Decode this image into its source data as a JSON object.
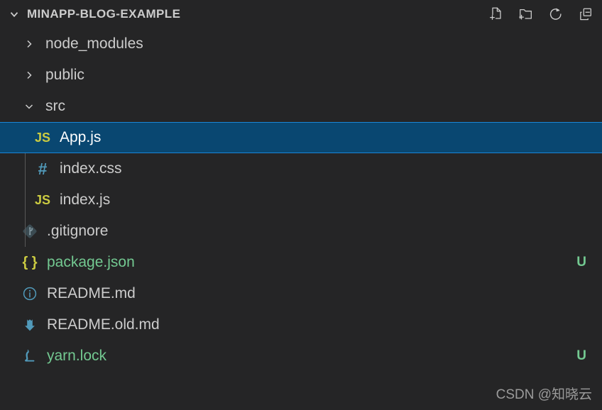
{
  "header": {
    "title": "MINAPP-BLOG-EXAMPLE",
    "expanded": true,
    "actions": [
      {
        "name": "new-file-icon",
        "tooltip": "New File"
      },
      {
        "name": "new-folder-icon",
        "tooltip": "New Folder"
      },
      {
        "name": "refresh-icon",
        "tooltip": "Refresh Explorer"
      },
      {
        "name": "collapse-all-icon",
        "tooltip": "Collapse Folders in Explorer"
      }
    ]
  },
  "tree": [
    {
      "label": "node_modules",
      "type": "folder",
      "depth": 1,
      "expanded": false,
      "icon": "chevron-right-icon",
      "badge": "",
      "selected": false
    },
    {
      "label": "public",
      "type": "folder",
      "depth": 1,
      "expanded": false,
      "icon": "chevron-right-icon",
      "badge": "",
      "selected": false
    },
    {
      "label": "src",
      "type": "folder",
      "depth": 1,
      "expanded": true,
      "icon": "chevron-down-icon",
      "badge": "",
      "selected": false
    },
    {
      "label": "App.js",
      "type": "file",
      "depth": 2,
      "icon": "js-file-icon",
      "badge": "",
      "selected": true
    },
    {
      "label": "index.css",
      "type": "file",
      "depth": 2,
      "icon": "css-file-icon",
      "badge": "",
      "selected": false
    },
    {
      "label": "index.js",
      "type": "file",
      "depth": 2,
      "icon": "js-file-icon",
      "badge": "",
      "selected": false
    },
    {
      "label": ".gitignore",
      "type": "file",
      "depth": 1,
      "icon": "git-file-icon",
      "badge": "",
      "selected": false
    },
    {
      "label": "package.json",
      "type": "file",
      "depth": 1,
      "icon": "json-file-icon",
      "badge": "U",
      "selected": false,
      "untracked": true
    },
    {
      "label": "README.md",
      "type": "file",
      "depth": 1,
      "icon": "info-file-icon",
      "badge": "",
      "selected": false
    },
    {
      "label": "README.old.md",
      "type": "file",
      "depth": 1,
      "icon": "download-arrow-icon",
      "badge": "",
      "selected": false
    },
    {
      "label": "yarn.lock",
      "type": "file",
      "depth": 1,
      "icon": "yarn-cat-icon",
      "badge": "U",
      "selected": false,
      "untracked": true
    }
  ],
  "watermark": "CSDN @知晓云",
  "colors": {
    "background": "#252526",
    "selected_row": "#094771",
    "selected_border": "#1a85d6",
    "text": "#cccccc",
    "untracked": "#73c991",
    "js_icon": "#cbcb41",
    "css_icon": "#519aba",
    "blue_icon": "#519aba"
  }
}
